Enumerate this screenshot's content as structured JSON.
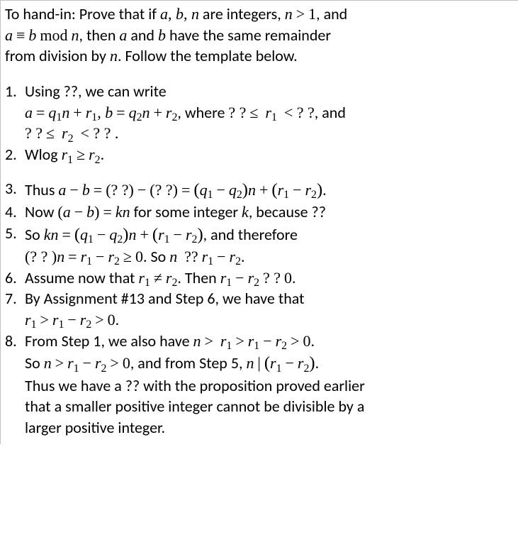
{
  "intro_l1_a": "To hand-in: Prove that if ",
  "intro_l1_b": " are integers, ",
  "intro_l1_c": ", and",
  "intro_l2_a": ", then ",
  "intro_l2_b": " and ",
  "intro_l2_c": "  have the same remainder",
  "intro_l3": "from division by ",
  "intro_l3_b": ".  Follow the template below.",
  "s1_num": "1.",
  "s1_a": "  Using ??, we can write",
  "s1_b_a": ", where ",
  "s1_b_b": ", and",
  "s2_num": "2.",
  "s2_a": "  Wlog ",
  "s3_num": "3.",
  "s3_a": "  Thus ",
  "s4_num": "4.",
  "s4_a": "  Now ",
  "s4_b": " for some integer ",
  "s4_c": ", because ??",
  "s5_num": "5.",
  "s5_a": "  So ",
  "s5_b": ", and therefore",
  "s5_c": ". So ",
  "s6_num": "6.",
  "s6_a": "  Assume now that ",
  "s6_b": ". Then ",
  "s7_num": "7.",
  "s7_a": "  By Assignment #13 and Step 6, we have that",
  "s8_num": "8.",
  "s8_a": "  From Step 1, we also have ",
  "s8_c": "So ",
  "s8_d": ", and from Step 5, ",
  "s8_e": "Thus we have a ?? with the proposition proved earlier",
  "s8_f": "that a smaller positive integer cannot be divisible by a",
  "s8_g": "larger positive integer.",
  "math": {
    "abn": "a, b, n",
    "ngt1": "n > 1",
    "cong": "a ≡ b mod n",
    "a": "a",
    "b": "b",
    "n": "n",
    "eq1": "a = q₁n + r₁, b = q₂n + r₂",
    "cond_r1": "? ? ≤  r₁  < ? ?",
    "cond_r2": "? ? ≤  r₂  < ? ? .",
    "wlog": "r₁ ≥ r₂.",
    "diff": "a − b = (? ?) − (? ?) = (q₁ − q₂)n + (r₁ − r₂).",
    "ab_kn": "(a − b) = kn",
    "k": "k",
    "kn_eq": "kn = (q₁ − q₂)n + (r₁ − r₂)",
    "nn_r": "(? ? )n = r₁ − r₂ ≥ 0",
    "n_div_r": "n  ?? r₁ − r₂.",
    "r_neq": "r₁ ≠ r₂",
    "r_diff_q": "r₁ − r₂ ? ? 0.",
    "r1_gt": "r₁ > r₁ − r₂ > 0.",
    "n_gt_r": "n >  r₁ > r₁ − r₂ > 0.",
    "n_r_gt0": "n > r₁ − r₂ > 0",
    "n_div": "n | (r₁ − r₂)."
  }
}
